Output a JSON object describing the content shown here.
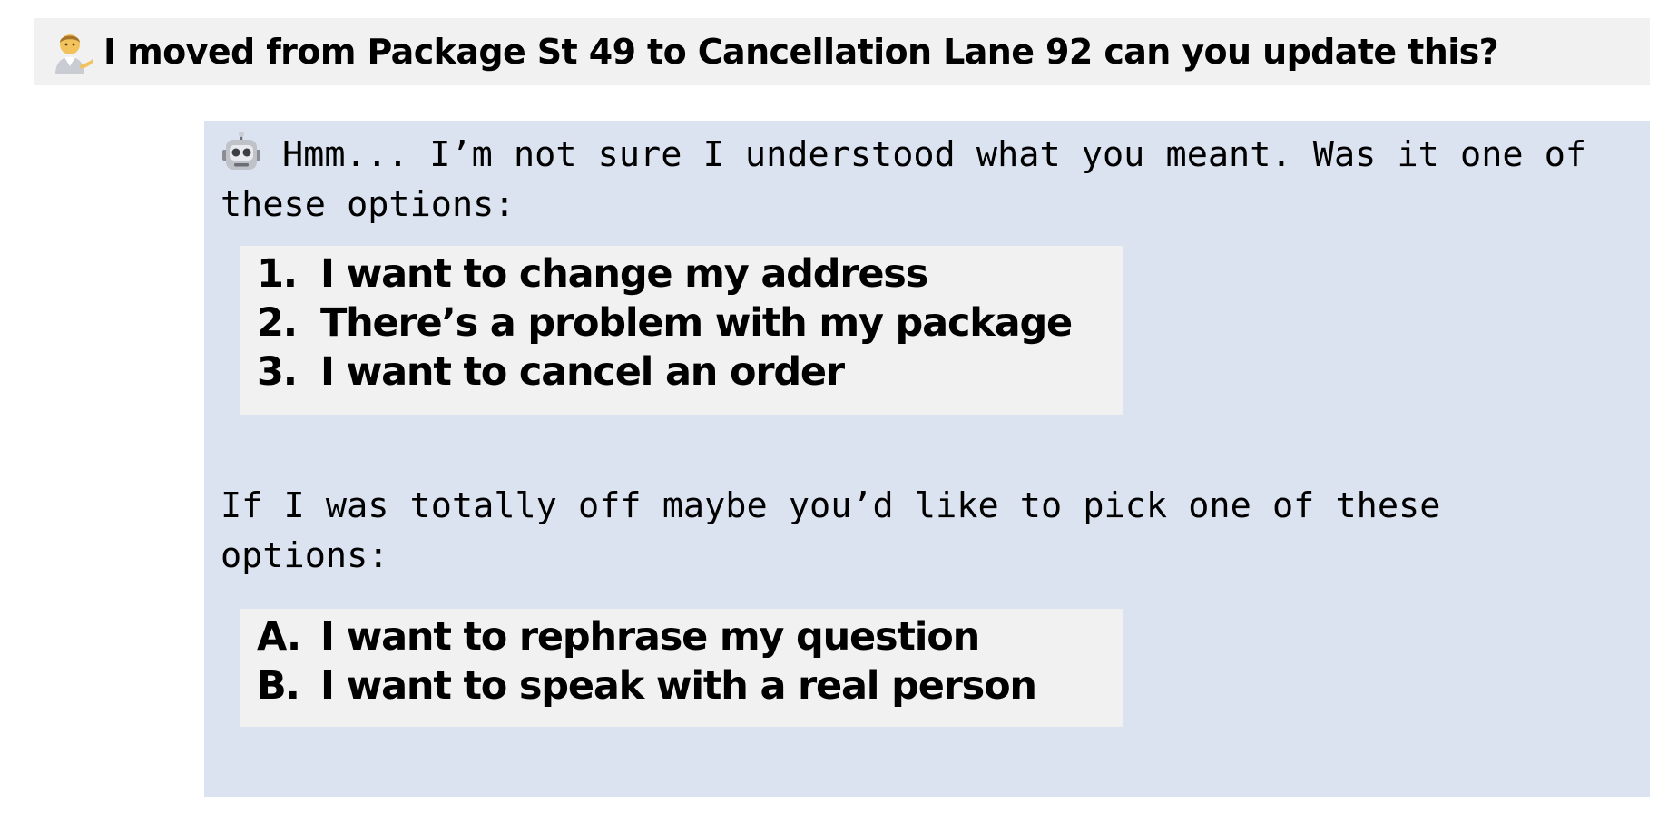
{
  "user_message": {
    "avatar_icon": "person-tipping-hand-icon",
    "text": "I moved from Package St 49 to Cancellation Lane 92 can you update this?"
  },
  "bot_message": {
    "avatar_icon": "robot-icon",
    "intro_text": "Hmm... I’m not sure I understood what you meant. Was it one of these options:",
    "suggestions": [
      {
        "key": "1.",
        "label": "I want to change my address"
      },
      {
        "key": "2.",
        "label": "There’s a problem with my package"
      },
      {
        "key": "3.",
        "label": "I want to cancel an order"
      }
    ],
    "fallback_text": "If I was totally off maybe you’d like to pick one of these options:",
    "fallback_options": [
      {
        "key": "A.",
        "label": "I want to rephrase my question"
      },
      {
        "key": "B.",
        "label": "I want to speak with a real person"
      }
    ]
  },
  "colors": {
    "user_bubble_bg": "#f1f1f1",
    "bot_bubble_bg": "#dce3f0",
    "option_box_bg": "#f1f1f1"
  }
}
